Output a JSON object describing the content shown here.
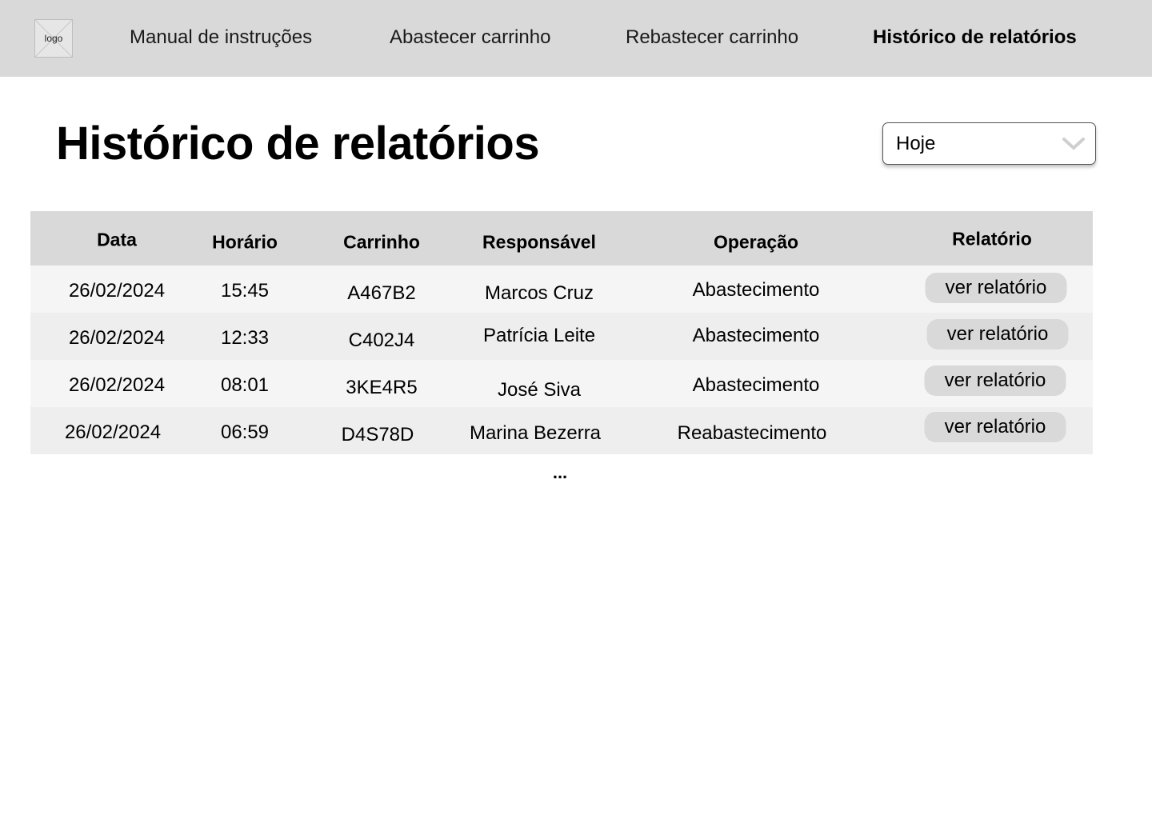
{
  "logo": {
    "label": "logo"
  },
  "nav": {
    "items": [
      {
        "label": "Manual de instruções",
        "active": false
      },
      {
        "label": "Abastecer carrinho",
        "active": false
      },
      {
        "label": "Rebastecer carrinho",
        "active": false
      },
      {
        "label": "Histórico de relatórios",
        "active": true
      }
    ]
  },
  "page": {
    "title": "Histórico de relatórios",
    "filter": {
      "selected": "Hoje",
      "icon": "chevron-down-icon"
    }
  },
  "table": {
    "columns": [
      "Data",
      "Horário",
      "Carrinho",
      "Responsável",
      "Operação",
      "Relatório"
    ],
    "rows": [
      {
        "data": "26/02/2024",
        "horario": "15:45",
        "carrinho": "A467B2",
        "responsavel": "Marcos Cruz",
        "operacao": "Abastecimento",
        "relatorio": "ver relatório"
      },
      {
        "data": "26/02/2024",
        "horario": "12:33",
        "carrinho": "C402J4",
        "responsavel": "Patrícia Leite",
        "operacao": "Abastecimento",
        "relatorio": "ver relatório"
      },
      {
        "data": "26/02/2024",
        "horario": "08:01",
        "carrinho": "3KE4R5",
        "responsavel": "José Siva",
        "operacao": "Abastecimento",
        "relatorio": "ver relatório"
      },
      {
        "data": "26/02/2024",
        "horario": "06:59",
        "carrinho": "D4S78D",
        "responsavel": "Marina Bezerra",
        "operacao": "Reabastecimento",
        "relatorio": "ver relatório"
      }
    ],
    "more_indicator": "..."
  },
  "colors": {
    "topbar": "#d9d9d9",
    "table_header": "#d9d9d9",
    "row_light": "#f5f5f5",
    "row_dark": "#eeeeee",
    "button": "#d9d9d9"
  }
}
